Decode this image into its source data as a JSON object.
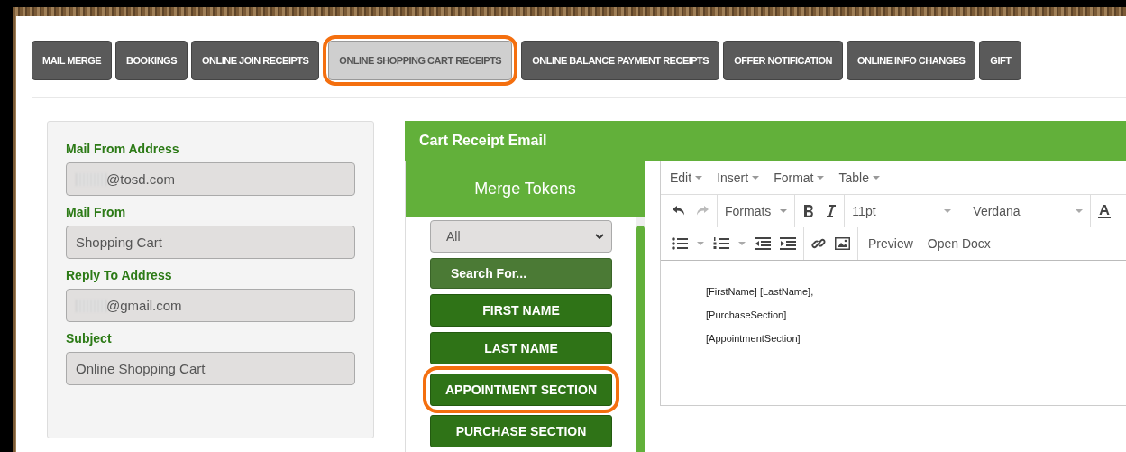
{
  "tabs": [
    {
      "label": "MAIL MERGE",
      "selected": false,
      "highlighted": false
    },
    {
      "label": "BOOKINGS",
      "selected": false,
      "highlighted": false
    },
    {
      "label": "ONLINE JOIN RECEIPTS",
      "selected": false,
      "highlighted": false
    },
    {
      "label": "ONLINE SHOPPING CART RECEIPTS",
      "selected": true,
      "highlighted": true
    },
    {
      "label": "ONLINE BALANCE PAYMENT RECEIPTS",
      "selected": false,
      "highlighted": false
    },
    {
      "label": "OFFER NOTIFICATION",
      "selected": false,
      "highlighted": false
    },
    {
      "label": "ONLINE INFO CHANGES",
      "selected": false,
      "highlighted": false
    },
    {
      "label": "GIFT",
      "selected": false,
      "highlighted": false
    }
  ],
  "settings": {
    "fields": [
      {
        "label": "Mail From Address",
        "value": "@tosd.com",
        "redacted": true
      },
      {
        "label": "Mail From",
        "value": "Shopping Cart",
        "redacted": false
      },
      {
        "label": "Reply To Address",
        "value": "@gmail.com",
        "redacted": true
      },
      {
        "label": "Subject",
        "value": "Online Shopping Cart",
        "redacted": false
      }
    ]
  },
  "email_panel": {
    "title": "Cart Receipt Email",
    "merge_tokens": {
      "title": "Merge Tokens",
      "filter": "All",
      "search_placeholder": "Search For...",
      "tokens": [
        {
          "label": "FIRST NAME",
          "highlighted": false
        },
        {
          "label": "LAST NAME",
          "highlighted": false
        },
        {
          "label": "APPOINTMENT SECTION",
          "highlighted": true
        },
        {
          "label": "PURCHASE SECTION",
          "highlighted": false
        }
      ]
    },
    "editor": {
      "menus": [
        "Edit",
        "Insert",
        "Format",
        "Table"
      ],
      "formats": "Formats",
      "font_size": "11pt",
      "font_family": "Verdana",
      "preview": "Preview",
      "open_docx": "Open Docx",
      "body": [
        "[FirstName] [LastName],",
        "[PurchaseSection]",
        "[AppointmentSection]"
      ]
    }
  }
}
